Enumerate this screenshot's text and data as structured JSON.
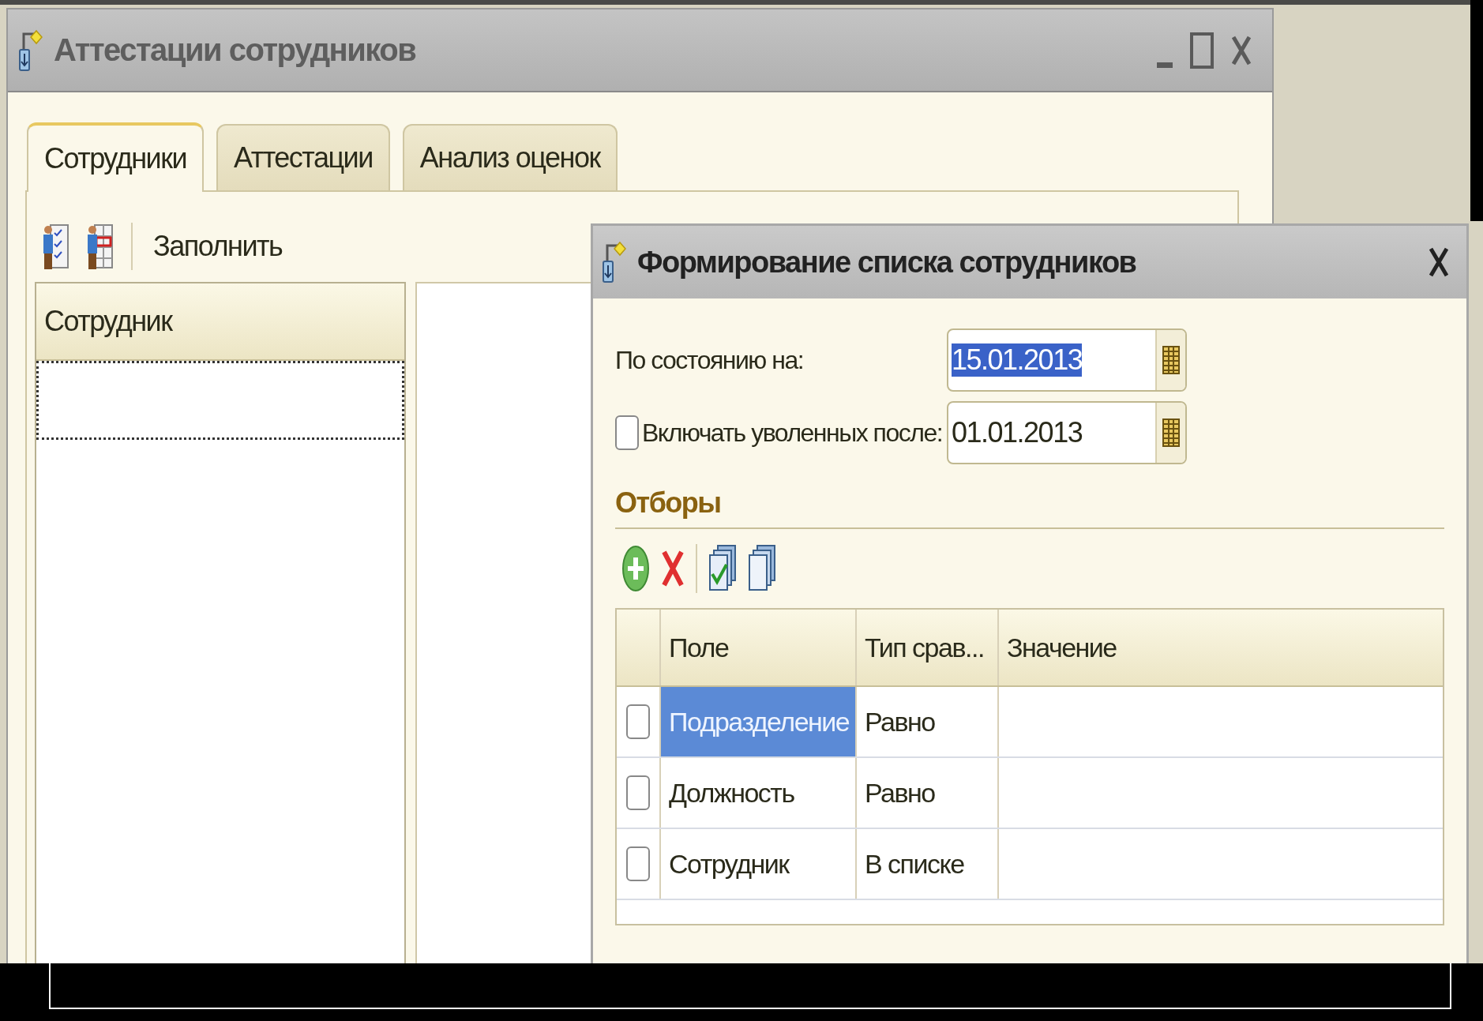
{
  "window": {
    "title": "Аттестации сотрудников"
  },
  "tabs": [
    {
      "label": "Сотрудники",
      "selected": true
    },
    {
      "label": "Аттестации",
      "selected": false
    },
    {
      "label": "Анализ оценок",
      "selected": false
    }
  ],
  "toolbar": {
    "fill_button": "Заполнить"
  },
  "employee_list": {
    "columns": [
      "Сотрудник"
    ]
  },
  "dialog": {
    "title": "Формирование списка сотрудников",
    "fields": [
      {
        "kind": "date",
        "label": "По состоянию на:",
        "value": "15.01.2013",
        "highlighted": true
      },
      {
        "kind": "checkbox_date",
        "label": "Включать уволенных после:",
        "checked": false,
        "value": "01.01.2013",
        "highlighted": false
      }
    ],
    "section": "Отборы",
    "filters": {
      "columns": [
        "Поле",
        "Тип срав...",
        "Значение"
      ],
      "rows": [
        {
          "checked": false,
          "field": "Подразделение",
          "comparison": "Равно",
          "selected": true
        },
        {
          "checked": false,
          "field": "Должность",
          "comparison": "Равно",
          "selected": false
        },
        {
          "checked": false,
          "field": "Сотрудник",
          "comparison": "В списке",
          "selected": false
        }
      ]
    }
  }
}
